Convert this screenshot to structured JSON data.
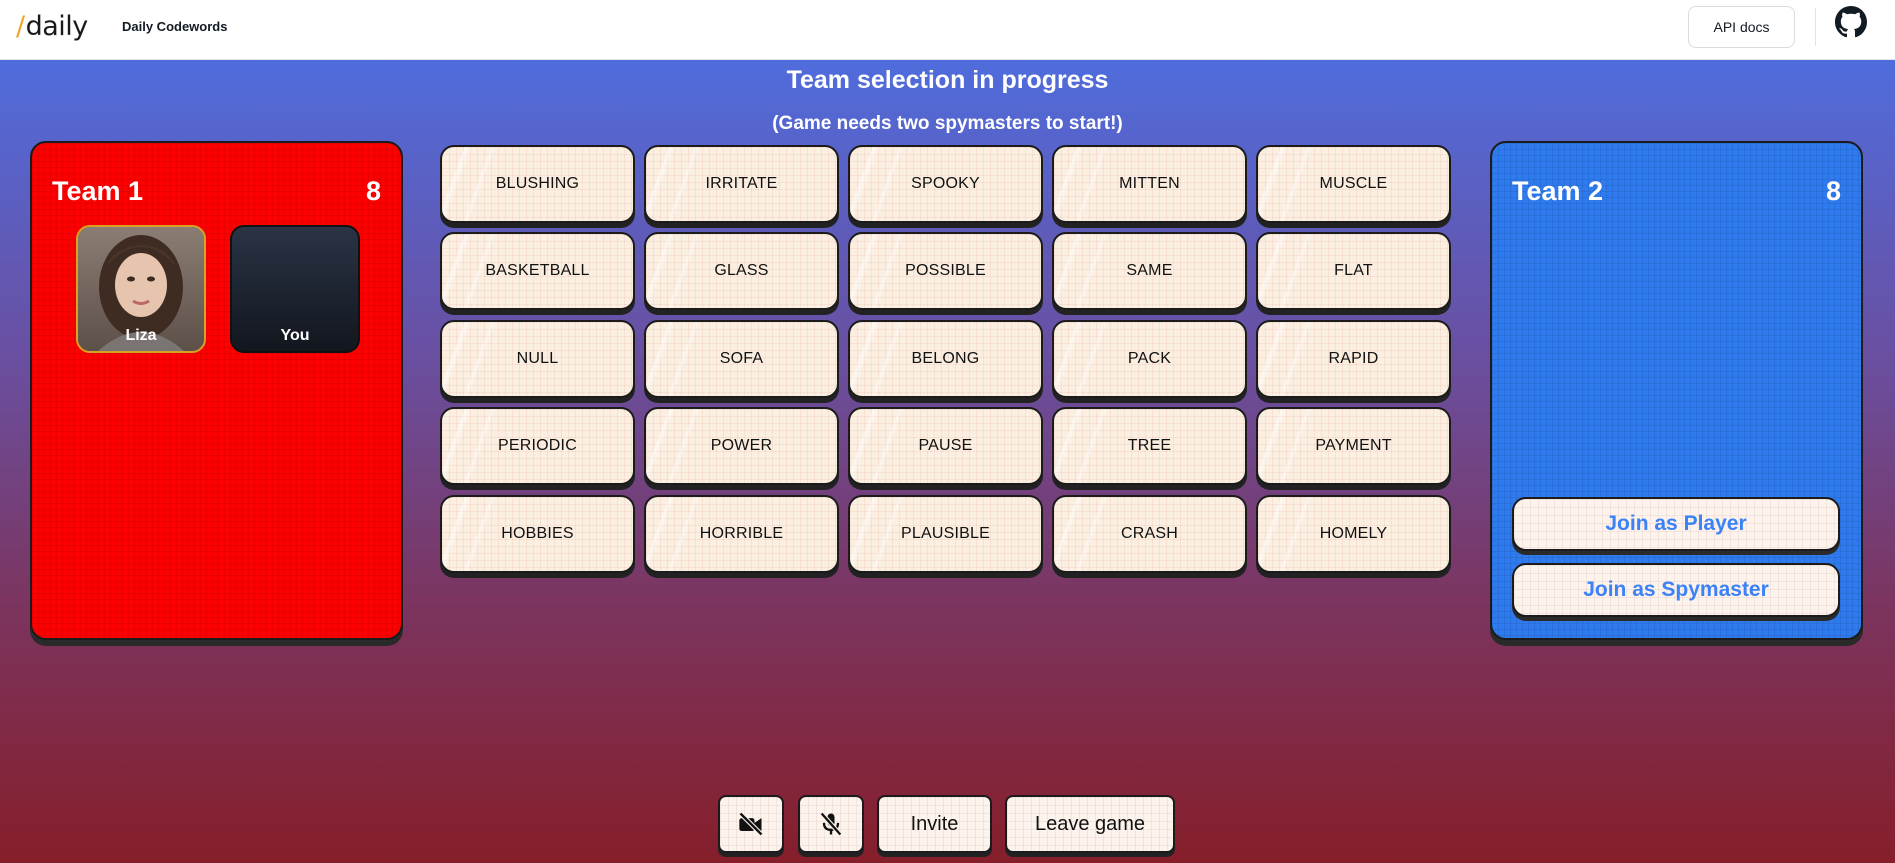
{
  "header": {
    "logo_text": "daily",
    "logo_slash": "/",
    "app_name": "Daily Codewords",
    "api_docs_label": "API docs",
    "github_icon": "github-icon"
  },
  "status": {
    "title": "Team selection in progress",
    "subtitle": "(Game needs two spymasters to start!)"
  },
  "team1": {
    "name": "Team 1",
    "score": "8",
    "color": "#ff0000",
    "players": [
      {
        "name": "Liza",
        "highlight": "#d9a223"
      },
      {
        "name": "You"
      }
    ]
  },
  "team2": {
    "name": "Team 2",
    "score": "8",
    "color": "#2e7bf0",
    "join_player_label": "Join as Player",
    "join_spymaster_label": "Join as Spymaster"
  },
  "words": [
    [
      "BLUSHING",
      "IRRITATE",
      "SPOOKY",
      "MITTEN",
      "MUSCLE"
    ],
    [
      "BASKETBALL",
      "GLASS",
      "POSSIBLE",
      "SAME",
      "FLAT"
    ],
    [
      "NULL",
      "SOFA",
      "BELONG",
      "PACK",
      "RAPID"
    ],
    [
      "PERIODIC",
      "POWER",
      "PAUSE",
      "TREE",
      "PAYMENT"
    ],
    [
      "HOBBIES",
      "HORRIBLE",
      "PLAUSIBLE",
      "CRASH",
      "HOMELY"
    ]
  ],
  "controls": {
    "camera_icon": "camera-off-icon",
    "mic_icon": "mic-off-icon",
    "invite_label": "Invite",
    "leave_label": "Leave game"
  }
}
